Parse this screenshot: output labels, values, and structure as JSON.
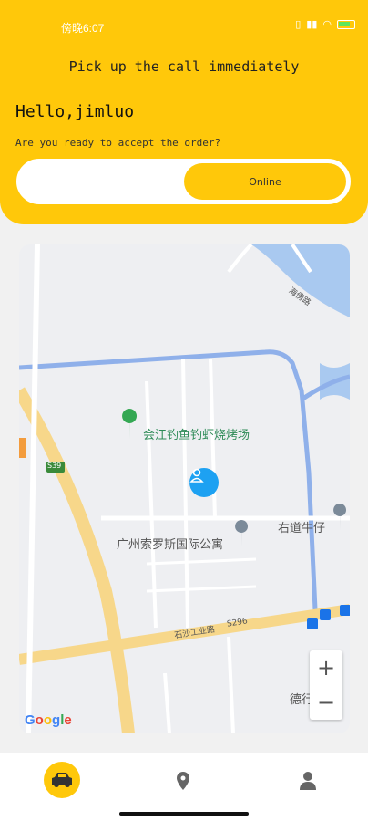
{
  "status_bar": {
    "time": "傍晚6:07"
  },
  "header": {
    "title": "Pick up the call immediately",
    "greeting": "Hello,jimluo",
    "question": "Are you ready to accept the order?",
    "toggle_label": "Online"
  },
  "map": {
    "labels": {
      "restaurant": "会江钓鱼钓虾烧烤场",
      "apartment": "广州索罗斯国际公寓",
      "right_place": "右道牛仔",
      "road_main": "石沙工业路",
      "road_code": "S296",
      "road_top": "海傍路",
      "highway_code": "S39",
      "bottom_right": "德行"
    },
    "zoom_in": "+",
    "zoom_out": "−",
    "attribution": "Google"
  },
  "nav": {
    "items": [
      "car-icon",
      "location-icon",
      "person-icon"
    ],
    "accent": "#ffc80a"
  }
}
